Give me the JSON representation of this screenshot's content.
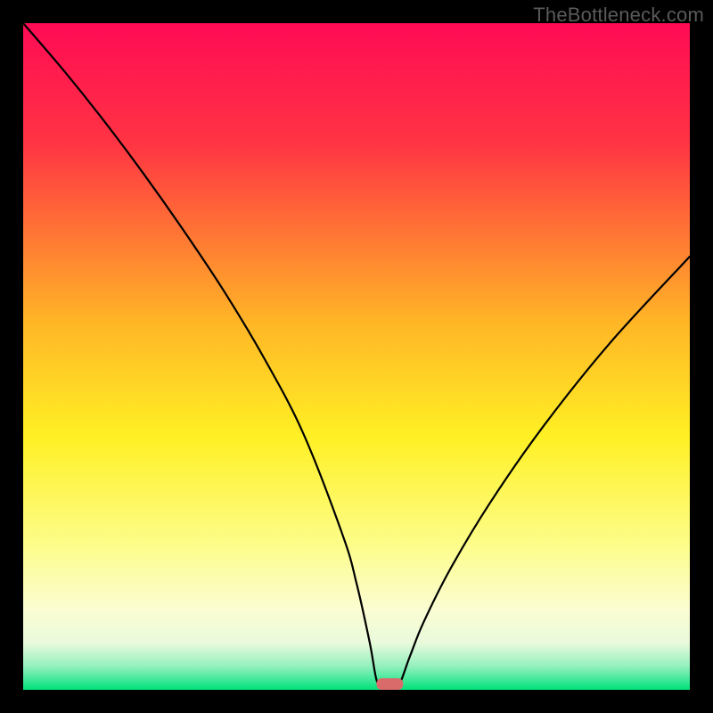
{
  "watermark": "TheBottleneck.com",
  "chart_data": {
    "type": "line",
    "title": "",
    "xlabel": "",
    "ylabel": "",
    "xlim": [
      0,
      100
    ],
    "ylim": [
      0,
      100
    ],
    "series": [
      {
        "name": "bottleneck-curve",
        "x": [
          0,
          6,
          12,
          18,
          24,
          30,
          36,
          42,
          48,
          50,
          52,
          53,
          54,
          56,
          58,
          60,
          64,
          70,
          78,
          88,
          100
        ],
        "values": [
          100,
          93,
          85.5,
          77.5,
          69,
          60,
          50,
          38.5,
          23,
          16,
          7,
          1.5,
          0,
          0,
          5,
          10,
          18,
          28,
          39.5,
          52,
          65
        ]
      }
    ],
    "marker": {
      "name": "optimal-marker",
      "x": 55,
      "y": 0,
      "width": 4,
      "color": "#d96b6b"
    },
    "background": {
      "type": "heatmap-gradient",
      "stops": [
        {
          "pos": 0,
          "color": "#ff0b55"
        },
        {
          "pos": 0.18,
          "color": "#ff3443"
        },
        {
          "pos": 0.45,
          "color": "#ffb626"
        },
        {
          "pos": 0.62,
          "color": "#fff024"
        },
        {
          "pos": 0.78,
          "color": "#fdfd88"
        },
        {
          "pos": 0.88,
          "color": "#fbfdd2"
        },
        {
          "pos": 0.93,
          "color": "#e8fadb"
        },
        {
          "pos": 0.965,
          "color": "#93f0be"
        },
        {
          "pos": 1.0,
          "color": "#00e27a"
        }
      ]
    }
  }
}
